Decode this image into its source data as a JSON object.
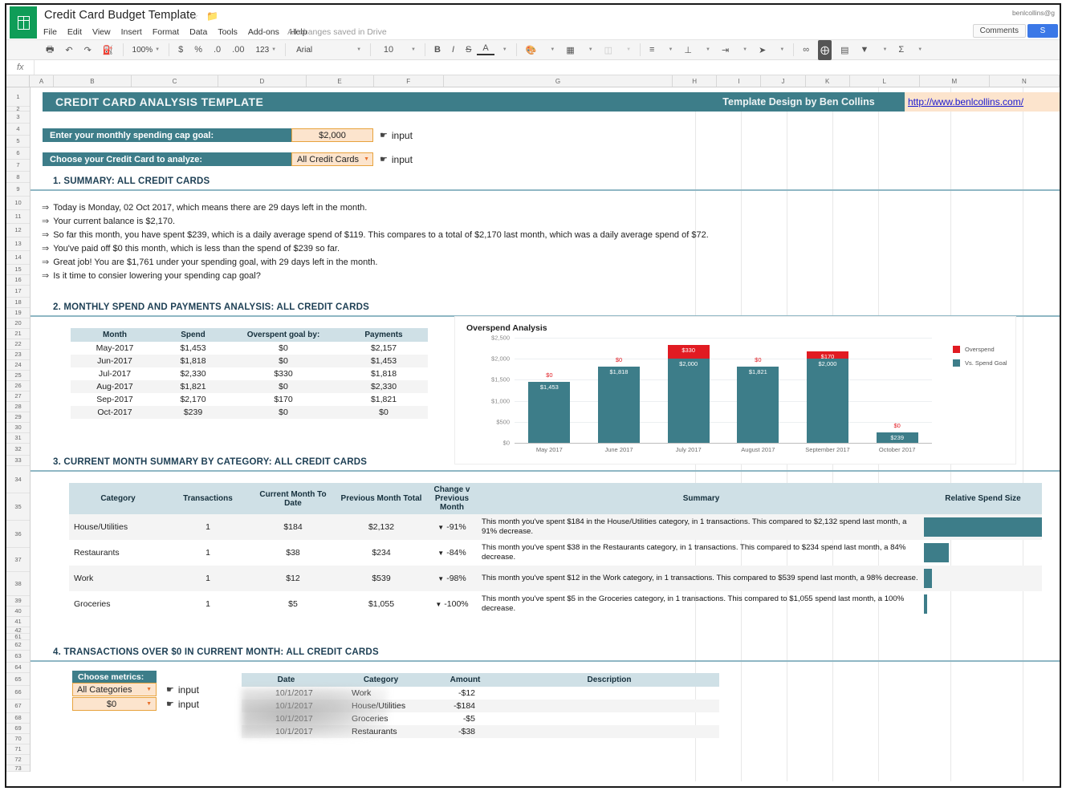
{
  "app": {
    "doc_title": "Credit Card Budget Template",
    "save_state": "All changes saved in Drive",
    "account_email": "benlcollins@g",
    "comments_label": "Comments",
    "share_label": "S",
    "menus": [
      "File",
      "Edit",
      "View",
      "Insert",
      "Format",
      "Data",
      "Tools",
      "Add-ons",
      "Help"
    ],
    "toolbar": {
      "zoom": "100%",
      "currency": "$",
      "percent": "%",
      "dec_less": ".0",
      "dec_more": ".00",
      "formats": "123",
      "font": "Arial",
      "font_size": "10",
      "bold": "B",
      "italic": "I",
      "strike": "S"
    },
    "formula_label": "fx"
  },
  "grid": {
    "columns": [
      "A",
      "B",
      "C",
      "D",
      "E",
      "F",
      "G",
      "H",
      "I",
      "J",
      "K",
      "L",
      "M",
      "N"
    ],
    "rows": [
      "1",
      "2",
      "3",
      "4",
      "5",
      "6",
      "7",
      "8",
      "9",
      "10",
      "11",
      "12",
      "13",
      "14",
      "15",
      "16",
      "17",
      "18",
      "19",
      "20",
      "21",
      "22",
      "23",
      "24",
      "25",
      "26",
      "27",
      "28",
      "29",
      "30",
      "31",
      "32",
      "33",
      "34",
      "35",
      "36",
      "37",
      "38",
      "39",
      "40",
      "41",
      "42",
      "61",
      "62",
      "63",
      "64",
      "65",
      "66",
      "67",
      "68",
      "69",
      "70",
      "71",
      "72",
      "73"
    ]
  },
  "header": {
    "title": "CREDIT CARD ANALYSIS TEMPLATE",
    "credit": "Template Design by Ben Collins",
    "url": "http://www.benlcollins.com/"
  },
  "inputs": {
    "cap_goal_label": "Enter your monthly spending cap goal:",
    "cap_goal_value": "$2,000",
    "card_label": "Choose your Credit Card to analyze:",
    "card_value": "All Credit Cards",
    "input_hint": "input"
  },
  "section1": {
    "heading": "1. SUMMARY: ALL CREDIT CARDS",
    "bullets": [
      "Today is Monday, 02 Oct 2017, which means there are 29 days left in the month.",
      "Your current balance is $2,170.",
      "So far this month, you have spent $239, which is a daily average spend of $119. This compares to a total of $2,170 last month, which was a daily average spend of $72.",
      "You've paid off $0 this month, which is less than the spend of $239 so far.",
      "Great job! You are $1,761 under your spending goal, with 29 days left in the month.",
      "Is it time to consier lowering your spending cap goal?"
    ]
  },
  "section2": {
    "heading": "2. MONTHLY SPEND AND PAYMENTS ANALYSIS: ALL CREDIT CARDS",
    "table": {
      "headers": [
        "Month",
        "Spend",
        "Overspent goal by:",
        "Payments"
      ],
      "rows": [
        [
          "May-2017",
          "$1,453",
          "$0",
          "$2,157"
        ],
        [
          "Jun-2017",
          "$1,818",
          "$0",
          "$1,453"
        ],
        [
          "Jul-2017",
          "$2,330",
          "$330",
          "$1,818"
        ],
        [
          "Aug-2017",
          "$1,821",
          "$0",
          "$2,330"
        ],
        [
          "Sep-2017",
          "$2,170",
          "$170",
          "$1,821"
        ],
        [
          "Oct-2017",
          "$239",
          "$0",
          "$0"
        ]
      ]
    }
  },
  "section3": {
    "heading": "3. CURRENT MONTH SUMMARY BY CATEGORY: ALL CREDIT CARDS",
    "table": {
      "headers": [
        "Category",
        "Transactions",
        "Current Month To Date",
        "Previous Month Total",
        "Change v Previous Month",
        "Summary",
        "Relative Spend Size"
      ],
      "rows": [
        {
          "category": "House/Utilities",
          "transactions": "1",
          "current": "$184",
          "previous": "$2,132",
          "change": "-91%",
          "summary": "This month you've spent $184 in the House/Utilities category, in 1 transactions. This compared to $2,132 spend last month, a 91% decrease.",
          "relative_pct": 100
        },
        {
          "category": "Restaurants",
          "transactions": "1",
          "current": "$38",
          "previous": "$234",
          "change": "-84%",
          "summary": "This month you've spent $38 in the Restaurants category, in 1 transactions. This compared to $234 spend last month, a 84% decrease.",
          "relative_pct": 21
        },
        {
          "category": "Work",
          "transactions": "1",
          "current": "$12",
          "previous": "$539",
          "change": "-98%",
          "summary": "This month you've spent $12 in the Work category, in 1 transactions. This compared to $539 spend last month, a 98% decrease.",
          "relative_pct": 6.5
        },
        {
          "category": "Groceries",
          "transactions": "1",
          "current": "$5",
          "previous": "$1,055",
          "change": "-100%",
          "summary": "This month you've spent $5 in the Groceries category, in 1 transactions. This compared to $1,055 spend last month, a 100% decrease.",
          "relative_pct": 2.7
        }
      ]
    }
  },
  "section4": {
    "heading": "4. TRANSACTIONS OVER $0 IN CURRENT MONTH: ALL CREDIT CARDS",
    "metrics_label": "Choose metrics:",
    "metric_category": "All Categories",
    "metric_amount": "$0",
    "input_hint": "input",
    "table": {
      "headers": [
        "Date",
        "Category",
        "Amount",
        "Description"
      ],
      "rows": [
        [
          "10/1/2017",
          "Work",
          "-$12",
          ""
        ],
        [
          "10/1/2017",
          "House/Utilities",
          "-$184",
          ""
        ],
        [
          "10/1/2017",
          "Groceries",
          "-$5",
          ""
        ],
        [
          "10/1/2017",
          "Restaurants",
          "-$38",
          ""
        ]
      ]
    }
  },
  "colors": {
    "teal": "#3d7d89",
    "red": "#e11b22",
    "header_blue": "#cfe0e6",
    "input_orange": "#fce4cd"
  },
  "chart_data": {
    "type": "bar",
    "stacked": true,
    "title": "Overspend Analysis",
    "categories": [
      "May 2017",
      "June 2017",
      "July 2017",
      "August 2017",
      "September 2017",
      "October 2017"
    ],
    "series": [
      {
        "name": "Vs. Spend Goal",
        "color": "#3d7d89",
        "values": [
          1453,
          1818,
          2000,
          1821,
          2000,
          239
        ],
        "labels": [
          "$1,453",
          "$1,818",
          "$2,000",
          "$1,821",
          "$2,000",
          "$239"
        ]
      },
      {
        "name": "Overspend",
        "color": "#e11b22",
        "values": [
          0,
          0,
          330,
          0,
          170,
          0
        ],
        "labels": [
          "$0",
          "$0",
          "$330",
          "$0",
          "$170",
          "$0"
        ]
      }
    ],
    "ylim": [
      0,
      2500
    ],
    "yticks": [
      0,
      500,
      1000,
      1500,
      2000,
      2500
    ],
    "ytick_labels": [
      "$0",
      "$500",
      "$1,000",
      "$1,500",
      "$2,000",
      "$2,500"
    ],
    "xlabel": "",
    "ylabel": "",
    "grid": true,
    "legend_position": "right",
    "legend": [
      "Overspend",
      "Vs. Spend Goal"
    ]
  }
}
